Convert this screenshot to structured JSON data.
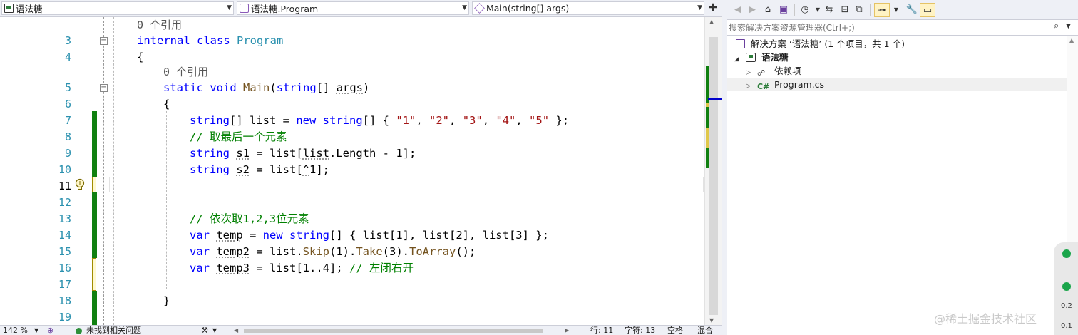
{
  "editor": {
    "nav": {
      "project": "语法糖",
      "class": "语法糖.Program",
      "member": "Main(string[] args)"
    },
    "lines": [
      {
        "num": "3",
        "tokens": [
          {
            "t": "internal",
            "c": "kw"
          },
          {
            "t": " "
          },
          {
            "t": "class",
            "c": "kw"
          },
          {
            "t": " "
          },
          {
            "t": "Program",
            "c": "ty"
          }
        ]
      },
      {
        "num": "4",
        "tokens": [
          {
            "t": "{"
          }
        ]
      },
      {
        "num": "5",
        "tokens": [
          {
            "t": "static",
            "c": "kw"
          },
          {
            "t": " "
          },
          {
            "t": "void",
            "c": "kw"
          },
          {
            "t": " "
          },
          {
            "t": "Main",
            "c": "fn"
          },
          {
            "t": "("
          },
          {
            "t": "string",
            "c": "kw"
          },
          {
            "t": "[] "
          },
          {
            "t": "args",
            "c": "sq"
          },
          {
            "t": ")"
          }
        ]
      },
      {
        "num": "6",
        "tokens": [
          {
            "t": "{"
          }
        ]
      },
      {
        "num": "7",
        "tokens": [
          {
            "t": "string",
            "c": "kw"
          },
          {
            "t": "[] list = "
          },
          {
            "t": "new",
            "c": "kw"
          },
          {
            "t": " "
          },
          {
            "t": "string",
            "c": "kw"
          },
          {
            "t": "[] { "
          },
          {
            "t": "\"1\"",
            "c": "str"
          },
          {
            "t": ", "
          },
          {
            "t": "\"2\"",
            "c": "str"
          },
          {
            "t": ", "
          },
          {
            "t": "\"3\"",
            "c": "str"
          },
          {
            "t": ", "
          },
          {
            "t": "\"4\"",
            "c": "str"
          },
          {
            "t": ", "
          },
          {
            "t": "\"5\"",
            "c": "str"
          },
          {
            "t": " };"
          }
        ]
      },
      {
        "num": "8",
        "tokens": [
          {
            "t": "// 取最后一个元素",
            "c": "cm"
          }
        ]
      },
      {
        "num": "9",
        "tokens": [
          {
            "t": "string",
            "c": "kw"
          },
          {
            "t": " "
          },
          {
            "t": "s1",
            "c": "sq"
          },
          {
            "t": " = list["
          },
          {
            "t": "list",
            "c": "sq"
          },
          {
            "t": ".Length - 1];"
          }
        ]
      },
      {
        "num": "10",
        "tokens": [
          {
            "t": "string",
            "c": "kw"
          },
          {
            "t": " "
          },
          {
            "t": "s2",
            "c": "sq"
          },
          {
            "t": " = list["
          },
          {
            "t": "^",
            "c": "sq"
          },
          {
            "t": "1];"
          }
        ]
      },
      {
        "num": "11",
        "tokens": []
      },
      {
        "num": "12",
        "tokens": []
      },
      {
        "num": "13",
        "tokens": [
          {
            "t": "// 依次取1,2,3位元素",
            "c": "cm"
          }
        ]
      },
      {
        "num": "14",
        "tokens": [
          {
            "t": "var",
            "c": "kw"
          },
          {
            "t": " "
          },
          {
            "t": "temp",
            "c": "sq"
          },
          {
            "t": " = "
          },
          {
            "t": "new",
            "c": "kw"
          },
          {
            "t": " "
          },
          {
            "t": "string",
            "c": "kw"
          },
          {
            "t": "[] { list[1], list[2], list[3] };"
          }
        ]
      },
      {
        "num": "15",
        "tokens": [
          {
            "t": "var",
            "c": "kw"
          },
          {
            "t": " "
          },
          {
            "t": "temp2",
            "c": "sq"
          },
          {
            "t": " = list."
          },
          {
            "t": "Skip",
            "c": "fn"
          },
          {
            "t": "(1)."
          },
          {
            "t": "Take",
            "c": "fn"
          },
          {
            "t": "(3)."
          },
          {
            "t": "ToArray",
            "c": "fn"
          },
          {
            "t": "();"
          }
        ]
      },
      {
        "num": "16",
        "tokens": [
          {
            "t": "var",
            "c": "kw"
          },
          {
            "t": " "
          },
          {
            "t": "temp3",
            "c": "sq"
          },
          {
            "t": " = list[1..4]; "
          },
          {
            "t": "// 左闭右开",
            "c": "cm"
          }
        ]
      },
      {
        "num": "17",
        "tokens": []
      },
      {
        "num": "18",
        "tokens": [
          {
            "t": "}"
          }
        ]
      },
      {
        "num": "19",
        "tokens": []
      }
    ],
    "codelens_ref_1": "0 个引用",
    "codelens_ref_2": "0 个引用",
    "current_line": "11"
  },
  "statusbar": {
    "zoom": "142 %",
    "issues": "未找到相关问题",
    "line": "行: 11",
    "col": "字符: 13",
    "space": "空格",
    "eol": "混合"
  },
  "solution_explorer": {
    "search_placeholder": "搜索解决方案资源管理器(Ctrl+;)",
    "solution_prefix": "解决方案 ‘语法糖’ (1 个项目，共 1 个)",
    "project": "语法糖",
    "deps": "依赖项",
    "file": "Program.cs"
  },
  "widget": {
    "v1": "0.2",
    "v2": "0.1"
  },
  "watermark": "@稀土掘金技术社区",
  "colors": {
    "keyword": "#0000ff",
    "type": "#2b91af",
    "string": "#a31515",
    "comment": "#008000",
    "change_saved": "#108010"
  }
}
